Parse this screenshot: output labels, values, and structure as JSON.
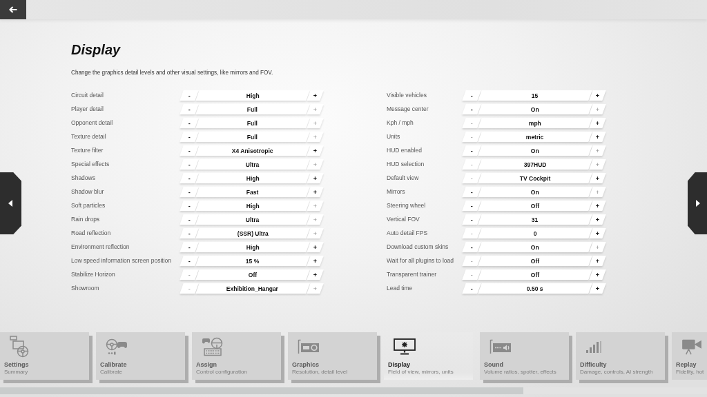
{
  "page": {
    "title": "Display",
    "description": "Change the graphics detail levels and other visual settings, like mirrors and FOV."
  },
  "settings_left": [
    {
      "label": "Circuit detail",
      "value": "High",
      "decrease": {
        "text": "-",
        "disabled": false
      },
      "increase": {
        "text": "+",
        "disabled": false
      }
    },
    {
      "label": "Player detail",
      "value": "Full",
      "decrease": {
        "text": "-",
        "disabled": false
      },
      "increase": {
        "text": "+",
        "disabled": true
      }
    },
    {
      "label": "Opponent detail",
      "value": "Full",
      "decrease": {
        "text": "-",
        "disabled": false
      },
      "increase": {
        "text": "+",
        "disabled": true
      }
    },
    {
      "label": "Texture detail",
      "value": "Full",
      "decrease": {
        "text": "-",
        "disabled": false
      },
      "increase": {
        "text": "+",
        "disabled": true
      }
    },
    {
      "label": "Texture filter",
      "value": "X4 Anisotropic",
      "decrease": {
        "text": "-",
        "disabled": false
      },
      "increase": {
        "text": "+",
        "disabled": false
      }
    },
    {
      "label": "Special effects",
      "value": "Ultra",
      "decrease": {
        "text": "-",
        "disabled": false
      },
      "increase": {
        "text": "+",
        "disabled": true
      }
    },
    {
      "label": "Shadows",
      "value": "High",
      "decrease": {
        "text": "-",
        "disabled": false
      },
      "increase": {
        "text": "+",
        "disabled": false
      }
    },
    {
      "label": "Shadow blur",
      "value": "Fast",
      "decrease": {
        "text": "-",
        "disabled": false
      },
      "increase": {
        "text": "+",
        "disabled": false
      }
    },
    {
      "label": "Soft particles",
      "value": "High",
      "decrease": {
        "text": "-",
        "disabled": false
      },
      "increase": {
        "text": "+",
        "disabled": true
      }
    },
    {
      "label": "Rain drops",
      "value": "Ultra",
      "decrease": {
        "text": "-",
        "disabled": false
      },
      "increase": {
        "text": "+",
        "disabled": true
      }
    },
    {
      "label": "Road reflection",
      "value": "(SSR) Ultra",
      "decrease": {
        "text": "-",
        "disabled": false
      },
      "increase": {
        "text": "+",
        "disabled": true
      }
    },
    {
      "label": "Environment reflection",
      "value": "High",
      "decrease": {
        "text": "-",
        "disabled": false
      },
      "increase": {
        "text": "+",
        "disabled": false
      }
    },
    {
      "label": "Low speed information screen position",
      "value": "15 %",
      "decrease": {
        "text": "-",
        "disabled": false
      },
      "increase": {
        "text": "+",
        "disabled": false
      }
    },
    {
      "label": "Stabilize Horizon",
      "value": "Off",
      "decrease": {
        "text": "-",
        "disabled": true
      },
      "increase": {
        "text": "+",
        "disabled": false
      }
    },
    {
      "label": "Showroom",
      "value": "Exhibition_Hangar",
      "decrease": {
        "text": "-",
        "disabled": true
      },
      "increase": {
        "text": "+",
        "disabled": true
      }
    }
  ],
  "settings_right": [
    {
      "label": "Visible vehicles",
      "value": "15",
      "decrease": {
        "text": "-",
        "disabled": false
      },
      "increase": {
        "text": "+",
        "disabled": false
      }
    },
    {
      "label": "Message center",
      "value": "On",
      "decrease": {
        "text": "-",
        "disabled": false
      },
      "increase": {
        "text": "+",
        "disabled": true
      }
    },
    {
      "label": "Kph / mph",
      "value": "mph",
      "decrease": {
        "text": "-",
        "disabled": true
      },
      "increase": {
        "text": "+",
        "disabled": false
      }
    },
    {
      "label": "Units",
      "value": "metric",
      "decrease": {
        "text": "-",
        "disabled": true
      },
      "increase": {
        "text": "+",
        "disabled": false
      }
    },
    {
      "label": "HUD enabled",
      "value": "On",
      "decrease": {
        "text": "-",
        "disabled": false
      },
      "increase": {
        "text": "+",
        "disabled": true
      }
    },
    {
      "label": "HUD selection",
      "value": "397HUD",
      "decrease": {
        "text": "-",
        "disabled": true
      },
      "increase": {
        "text": "+",
        "disabled": true
      }
    },
    {
      "label": "Default view",
      "value": "TV Cockpit",
      "decrease": {
        "text": "-",
        "disabled": true
      },
      "increase": {
        "text": "+",
        "disabled": false
      }
    },
    {
      "label": "Mirrors",
      "value": "On",
      "decrease": {
        "text": "-",
        "disabled": false
      },
      "increase": {
        "text": "+",
        "disabled": true
      }
    },
    {
      "label": "Steering wheel",
      "value": "Off",
      "decrease": {
        "text": "-",
        "disabled": false
      },
      "increase": {
        "text": "+",
        "disabled": false
      }
    },
    {
      "label": "Vertical FOV",
      "value": "31",
      "decrease": {
        "text": "-",
        "disabled": false
      },
      "increase": {
        "text": "+",
        "disabled": false
      }
    },
    {
      "label": "Auto detail FPS",
      "value": "0",
      "decrease": {
        "text": "-",
        "disabled": true
      },
      "increase": {
        "text": "+",
        "disabled": false
      }
    },
    {
      "label": "Download custom skins",
      "value": "On",
      "decrease": {
        "text": "-",
        "disabled": false
      },
      "increase": {
        "text": "+",
        "disabled": true
      }
    },
    {
      "label": "Wait for all plugins to load",
      "value": "Off",
      "decrease": {
        "text": "-",
        "disabled": true
      },
      "increase": {
        "text": "+",
        "disabled": false
      }
    },
    {
      "label": "Transparent trainer",
      "value": "Off",
      "decrease": {
        "text": "-",
        "disabled": true
      },
      "increase": {
        "text": "+",
        "disabled": false
      }
    },
    {
      "label": "Lead time",
      "value": "0.50 s",
      "decrease": {
        "text": "-",
        "disabled": false
      },
      "increase": {
        "text": "+",
        "disabled": false
      }
    }
  ],
  "nav_tabs": [
    {
      "kind": "settings",
      "title": "Settings",
      "subtitle": "Summary",
      "selected": false
    },
    {
      "kind": "calibrate",
      "title": "Calibrate",
      "subtitle": "Calibrate",
      "selected": false
    },
    {
      "kind": "assign",
      "title": "Assign",
      "subtitle": "Control configuration",
      "selected": false
    },
    {
      "kind": "graphics",
      "title": "Graphics",
      "subtitle": "Resolution, detail level",
      "selected": false
    },
    {
      "kind": "display",
      "title": "Display",
      "subtitle": "Field of view, mirrors, units",
      "selected": true
    },
    {
      "kind": "sound",
      "title": "Sound",
      "subtitle": "Volume ratios, spotter, effects",
      "selected": false
    },
    {
      "kind": "difficulty",
      "title": "Difficulty",
      "subtitle": "Damage, controls, AI strength",
      "selected": false
    },
    {
      "kind": "replay",
      "title": "Replay",
      "subtitle": "Fidelity, hot",
      "selected": false
    }
  ]
}
